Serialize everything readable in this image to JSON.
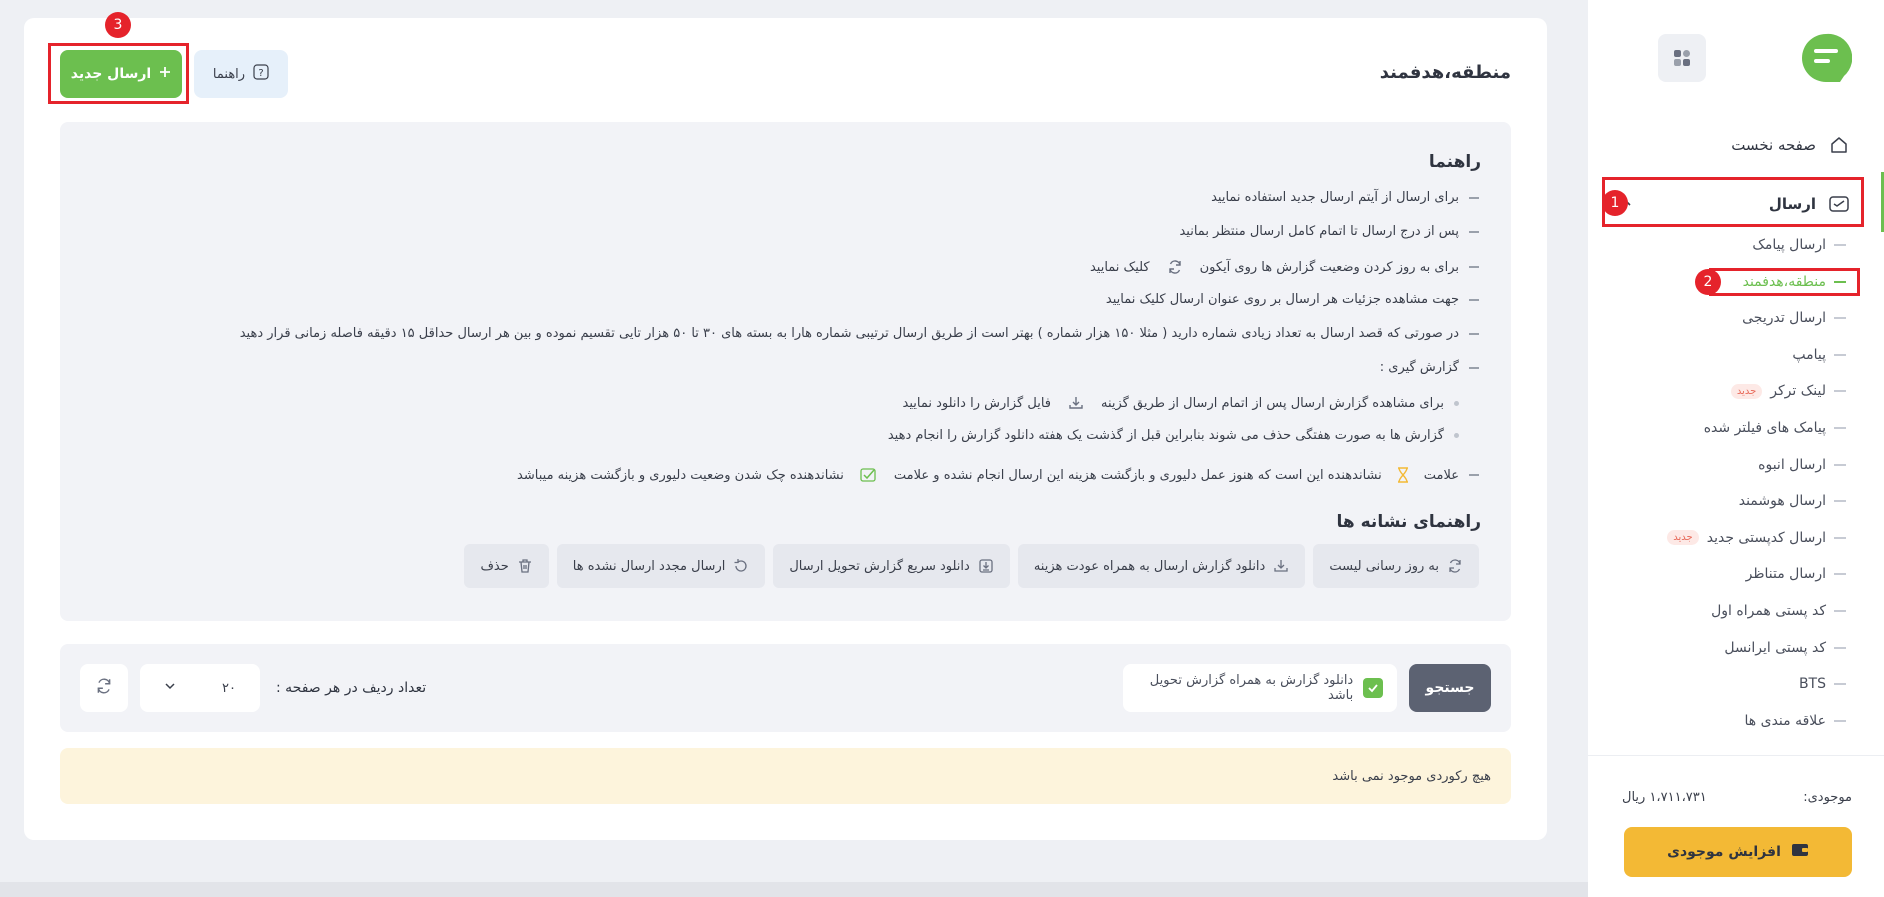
{
  "colors": {
    "accent": "#6cbf4f",
    "warning": "#f3b935",
    "annotation": "#e5232b"
  },
  "sidebar": {
    "home_label": "صفحه نخست",
    "send_label": "ارسال",
    "sub_items": [
      {
        "label": "ارسال پیامک"
      },
      {
        "label": "منطقه،هدفمند",
        "active": true
      },
      {
        "label": "ارسال تدریجی"
      },
      {
        "label": "پیامپ"
      },
      {
        "label": "لینک ترکر",
        "badge": "جدید"
      },
      {
        "label": "پیامک های فیلتر شده"
      },
      {
        "label": "ارسال انبوه"
      },
      {
        "label": "ارسال هوشمند"
      },
      {
        "label": "ارسال کدپستی جدید",
        "badge": "جدید"
      },
      {
        "label": "ارسال متناظر"
      },
      {
        "label": "کد پستی همراه اول"
      },
      {
        "label": "کد پستی ایرانسل"
      },
      {
        "label": "BTS"
      },
      {
        "label": "علاقه مندی ها"
      }
    ],
    "balance_label": "موجودی:",
    "balance_value": "۱،۷۱۱،۷۳۱ ریال",
    "increase_label": "افزایش موجودی"
  },
  "annotations": {
    "n1": "1",
    "n2": "2",
    "n3": "3"
  },
  "header": {
    "title": "منطقه،هدفمند",
    "new_send_label": "ارسال جدید",
    "guide_label": "راهنما"
  },
  "guide": {
    "title": "راهنما",
    "lines": {
      "l1": "برای ارسال از آیتم ارسال جدید استفاده نمایید",
      "l2": "پس از درج ارسال تا اتمام کامل ارسال منتظر بمانید",
      "l3a": "برای به روز کردن وضعیت گزارش ها روی آیکون",
      "l3b": "کلیک نمایید",
      "l4": "جهت مشاهده جزئیات هر ارسال بر روی عنوان ارسال کلیک نمایید",
      "l5": "در صورتی که قصد ارسال به تعداد زیادی شماره دارید ( مثلا ۱۵۰ هزار شماره ) بهتر است  از طریق ارسال ترتیبی شماره هارا به بسته های ۳۰ تا ۵۰ هزار تایی تقسیم نموده و بین هر ارسال حداقل ۱۵ دقیقه فاصله زمانی قرار دهید",
      "l6": "گزارش گیری :",
      "s1a": "برای مشاهده گزارش ارسال پس از اتمام ارسال از طریق گزینه",
      "s1b": "فایل گزارش را دانلود نمایید",
      "s2": "گزارش ها به صورت هفتگی حذف می شوند بنابراین قبل از گذشت یک هفته دانلود گزارش را انجام دهید",
      "l7a": "علامت",
      "l7b": "نشاندهنده این است که هنوز عمل دلیوری و بازگشت هزینه این ارسال انجام نشده و علامت",
      "l7c": "نشاندهنده چک شدن وضعیت دلیوری و بازگشت هزینه میباشد"
    }
  },
  "legend": {
    "title": "راهنمای نشانه ها",
    "chips": [
      {
        "label": "به روز رسانی لیست",
        "icon": "refresh-icon"
      },
      {
        "label": "دانلود گزارش ارسال به همراه عودت هزینه",
        "icon": "download-icon"
      },
      {
        "label": "دانلود سریع گزارش تحویل ارسال",
        "icon": "fast-download-icon"
      },
      {
        "label": "ارسال مجدد ارسال نشده ها",
        "icon": "resend-icon"
      },
      {
        "label": "حذف",
        "icon": "trash-icon"
      }
    ]
  },
  "filters": {
    "search_label": "جستجو",
    "checkbox_label": "دانلود گزارش به همراه گزارش تحویل باشد",
    "rows_label": "تعداد ردیف در هر صفحه :",
    "rows_value": "۲۰"
  },
  "empty_message": "هیچ رکوردی موجود نمی باشد"
}
